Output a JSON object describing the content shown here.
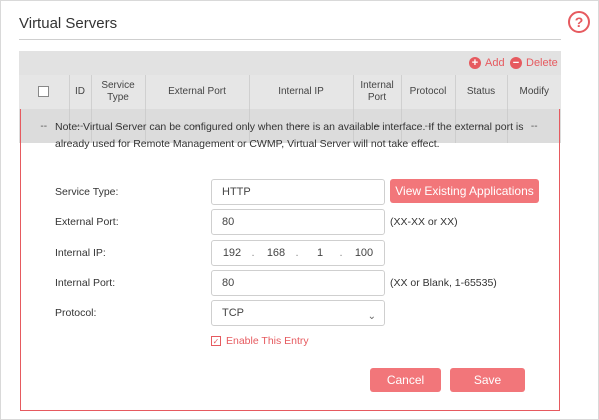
{
  "section": {
    "title": "Virtual Servers"
  },
  "toolbar": {
    "add_label": "Add",
    "delete_label": "Delete"
  },
  "table": {
    "headers": [
      "",
      "ID",
      "Service Type",
      "External Port",
      "Internal IP",
      "Internal Port",
      "Protocol",
      "Status",
      "Modify"
    ],
    "row": [
      "--",
      "--",
      "--",
      "--",
      "--",
      "--",
      "--",
      "--",
      "--"
    ]
  },
  "form": {
    "note": "Note: Virtual Server can be configured only when there is an available interface. If the external port is already used for Remote Management or CWMP, Virtual Server will not take effect.",
    "service_type_label": "Service Type:",
    "service_type_value": "HTTP",
    "view_apps_label": "View Existing Applications",
    "external_port_label": "External Port:",
    "external_port_value": "80",
    "external_port_hint": "(XX-XX or XX)",
    "internal_ip_label": "Internal IP:",
    "internal_ip": [
      "192",
      "168",
      "1",
      "100"
    ],
    "internal_ip_dot": ".",
    "internal_port_label": "Internal Port:",
    "internal_port_value": "80",
    "internal_port_hint": "(XX or Blank, 1-65535)",
    "protocol_label": "Protocol:",
    "protocol_value": "TCP",
    "enable_label": "Enable This Entry",
    "enable_checked": true,
    "cancel_label": "Cancel",
    "save_label": "Save"
  },
  "icons": {
    "help": "help-circle-icon",
    "add": "plus-circle-icon",
    "delete": "minus-circle-icon",
    "dropdown": "chevron-down-icon"
  },
  "colors": {
    "accent": "#e65a5f",
    "button": "#f2767a"
  }
}
